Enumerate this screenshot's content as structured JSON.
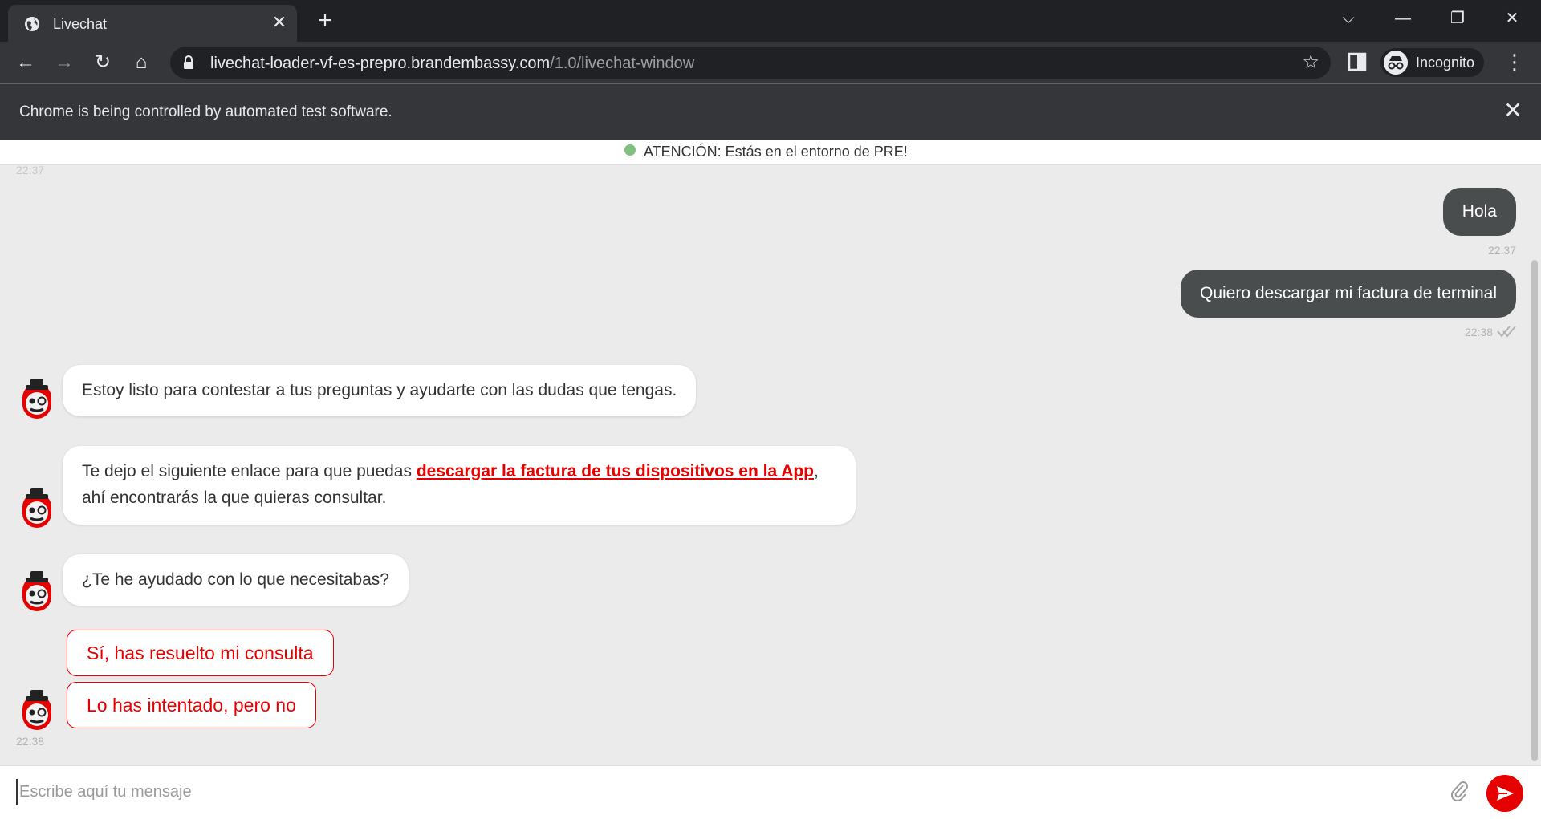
{
  "browser": {
    "tab_title": "Livechat",
    "url_main": "livechat-loader-vf-es-prepro.brandembassy.com",
    "url_path": "/1.0/livechat-window",
    "profile_label": "Incognito",
    "automation_notice": "Chrome is being controlled by automated test software."
  },
  "chat": {
    "env_banner": "ATENCIÓN: Estás en el entorno de PRE!",
    "top_timestamp": "22:37",
    "outgoing": [
      {
        "text": "Hola",
        "time": "22:37"
      },
      {
        "text": "Quiero descargar mi factura de terminal",
        "time": "22:38"
      }
    ],
    "incoming": {
      "msg1": "Estoy listo para contestar a tus preguntas y ayudarte con las dudas que tengas.",
      "msg2_before": "Te dejo el siguiente enlace para que puedas ",
      "msg2_link": "descargar la factura de tus dispositivos en la App",
      "msg2_after": ", ahí encontrarás la que quieras consultar.",
      "msg3": "¿Te he ayudado con lo que necesitabas?"
    },
    "quick_replies": [
      "Sí, has resuelto mi consulta",
      "Lo has intentado, pero no"
    ],
    "bottom_timestamp": "22:38",
    "composer_placeholder": "Escribe aquí tu mensaje"
  },
  "colors": {
    "brand_red": "#e60000",
    "outgoing_bubble": "#4a4d4e",
    "chat_background": "#ebebeb",
    "env_dot": "#7fbf7f"
  },
  "icons": [
    "globe-icon",
    "close-icon",
    "plus-icon",
    "chevron-down-icon",
    "minimize-icon",
    "restore-icon",
    "back-icon",
    "forward-icon",
    "reload-icon",
    "home-icon",
    "lock-icon",
    "star-icon",
    "side-panel-icon",
    "incognito-icon",
    "kebab-menu-icon",
    "read-receipt-icon",
    "bot-avatar-icon",
    "paperclip-icon",
    "send-icon"
  ]
}
